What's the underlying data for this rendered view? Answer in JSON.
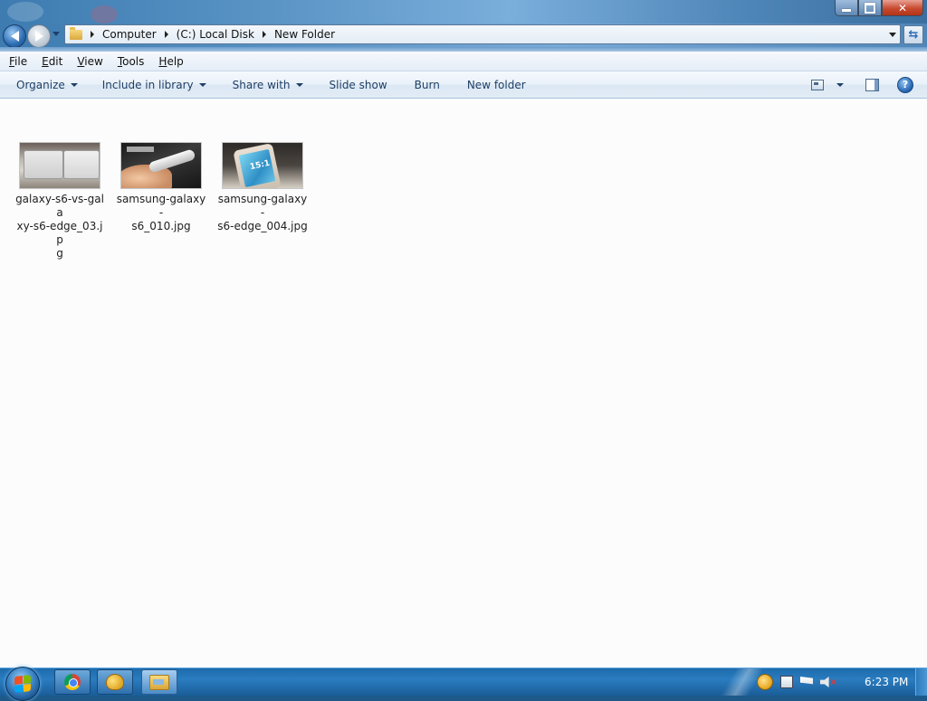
{
  "window": {
    "buttons": {
      "minimize": "minimize",
      "maximize": "maximize",
      "close": "close"
    }
  },
  "address": {
    "crumbs": [
      "Computer",
      "(C:) Local Disk",
      "New Folder"
    ]
  },
  "menu": {
    "items": [
      {
        "underline": "F",
        "rest": "ile"
      },
      {
        "underline": "E",
        "rest": "dit"
      },
      {
        "underline": "V",
        "rest": "iew"
      },
      {
        "underline": "T",
        "rest": "ools"
      },
      {
        "underline": "H",
        "rest": "elp"
      }
    ]
  },
  "commands": {
    "organize": "Organize",
    "include_in_library": "Include in library",
    "share_with": "Share with",
    "slide_show": "Slide show",
    "burn": "Burn",
    "new_folder": "New folder",
    "help_glyph": "?"
  },
  "files": [
    {
      "name": "galaxy-s6-vs-galaxy-s6-edge_03.jpg",
      "line1": "galaxy-s6-vs-gala",
      "line2": "xy-s6-edge_03.jp",
      "line3": "g"
    },
    {
      "name": "samsung-galaxy-s6_010.jpg",
      "line1": "samsung-galaxy-",
      "line2": "s6_010.jpg",
      "line3": ""
    },
    {
      "name": "samsung-galaxy-s6-edge_004.jpg",
      "line1": "samsung-galaxy-",
      "line2": "s6-edge_004.jpg",
      "line3": ""
    }
  ],
  "thumb3_time": "15:1",
  "taskbar": {
    "clock": "6:23 PM",
    "items": [
      "chrome-icon",
      "paint-icon",
      "explorer-icon"
    ]
  },
  "colors": {
    "taskbar": "#1d6bab",
    "close_button": "#c74a30",
    "command_text": "#1e3f66"
  }
}
